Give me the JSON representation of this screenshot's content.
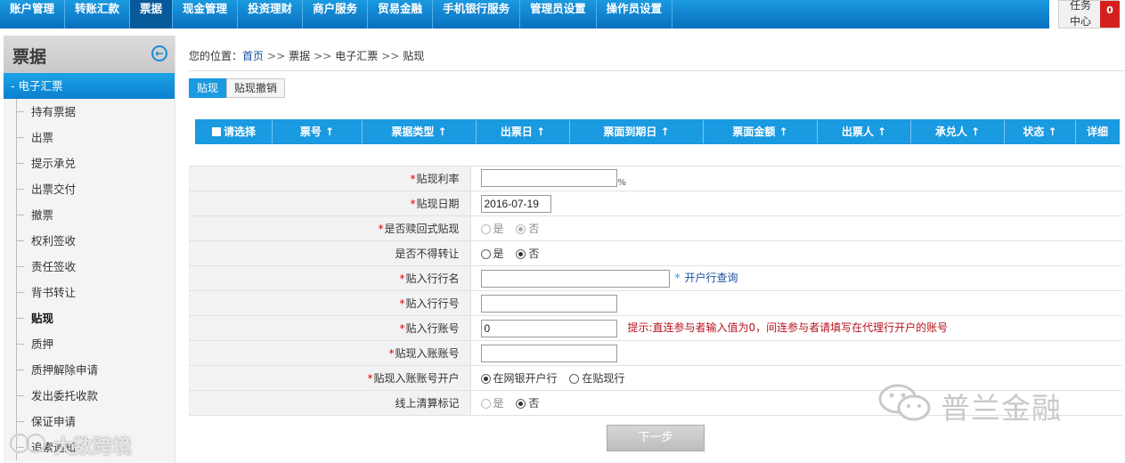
{
  "top_nav": {
    "items": [
      {
        "label": "账户管理",
        "active": false
      },
      {
        "label": "转账汇款",
        "active": false
      },
      {
        "label": "票据",
        "active": true
      },
      {
        "label": "现金管理",
        "active": false
      },
      {
        "label": "投资理财",
        "active": false
      },
      {
        "label": "商户服务",
        "active": false
      },
      {
        "label": "贸易金融",
        "active": false
      },
      {
        "label": "手机银行服务",
        "active": false
      },
      {
        "label": "管理员设置",
        "active": false
      },
      {
        "label": "操作员设置",
        "active": false
      }
    ],
    "task_center": {
      "label": "任务中心",
      "count": "0"
    }
  },
  "sidebar": {
    "title": "票据",
    "group": "- 电子汇票",
    "items": [
      "持有票据",
      "出票",
      "提示承兑",
      "出票交付",
      "撤票",
      "权利签收",
      "责任签收",
      "背书转让",
      "贴现",
      "质押",
      "质押解除申请",
      "发出委托收款",
      "保证申请",
      "追索通知"
    ],
    "active_item": "贴现"
  },
  "breadcrumb": {
    "prefix": "您的位置：",
    "home": "首页",
    "sep": ">>",
    "level1": "票据",
    "level2": "电子汇票",
    "current": "贴现"
  },
  "tabs": [
    {
      "label": "贴现",
      "active": true
    },
    {
      "label": "贴现撤销",
      "active": false
    }
  ],
  "grid_columns": [
    "请选择",
    "票号 ↑",
    "票据类型 ↑",
    "出票日 ↑",
    "票面到期日 ↑",
    "票面金额 ↑",
    "出票人 ↑",
    "承兑人 ↑",
    "状态 ↑",
    "详细"
  ],
  "form": {
    "rate": {
      "label": "贴现利率",
      "required": "*",
      "value": "",
      "unit": "%"
    },
    "date": {
      "label": "贴现日期",
      "required": "*",
      "value": "2016-07-19"
    },
    "redeem": {
      "label": "是否赎回式贴现",
      "required": "*",
      "options": [
        "是",
        "否"
      ],
      "selected": "否"
    },
    "no_transfer": {
      "label": "是否不得转让",
      "options": [
        "是",
        "否"
      ],
      "selected": "否"
    },
    "bank_name": {
      "label": "贴入行行名",
      "required": "*",
      "value": "",
      "lookup_star": "*",
      "lookup": "开户行查询"
    },
    "bank_no": {
      "label": "贴入行行号",
      "required": "*",
      "value": ""
    },
    "bank_account": {
      "label": "贴入行账号",
      "required": "*",
      "value": "0",
      "hint": "提示:直连参与者输入值为0，间连参与者请填写在代理行开户的账号"
    },
    "in_account": {
      "label": "贴现入账账号",
      "required": "*",
      "value": ""
    },
    "in_account_bank": {
      "label": "贴现入账账号开户",
      "required": "*",
      "options": [
        "在网银开户行",
        "在贴现行"
      ],
      "selected": "在网银开户行"
    },
    "online_clearing": {
      "label": "线上清算标记",
      "options": [
        "是",
        "否"
      ],
      "selected": "否"
    }
  },
  "next_button": "下一步",
  "watermarks": {
    "right": "普兰金融",
    "left": "大数跨境"
  },
  "colors": {
    "primary_blue": "#1a9ae0",
    "badge_red": "#d4201d",
    "hint_red": "#b5121b"
  }
}
